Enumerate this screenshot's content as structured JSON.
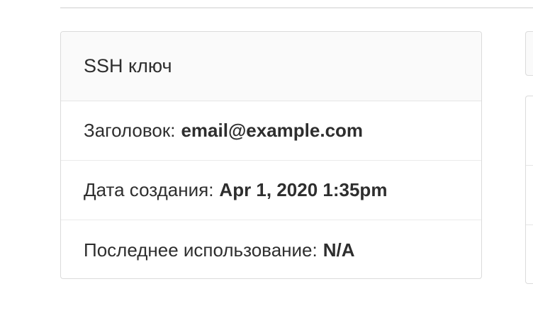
{
  "card": {
    "title": "SSH ключ",
    "rows": [
      {
        "label": "Заголовок:",
        "value": "email@example.com"
      },
      {
        "label": "Дата создания:",
        "value": "Apr 1, 2020 1:35pm"
      },
      {
        "label": "Последнее использование:",
        "value": "N/A"
      }
    ]
  },
  "colors": {
    "header_bg": "#fafafa",
    "border": "#dbdbdb",
    "text": "#2e2e2e"
  }
}
